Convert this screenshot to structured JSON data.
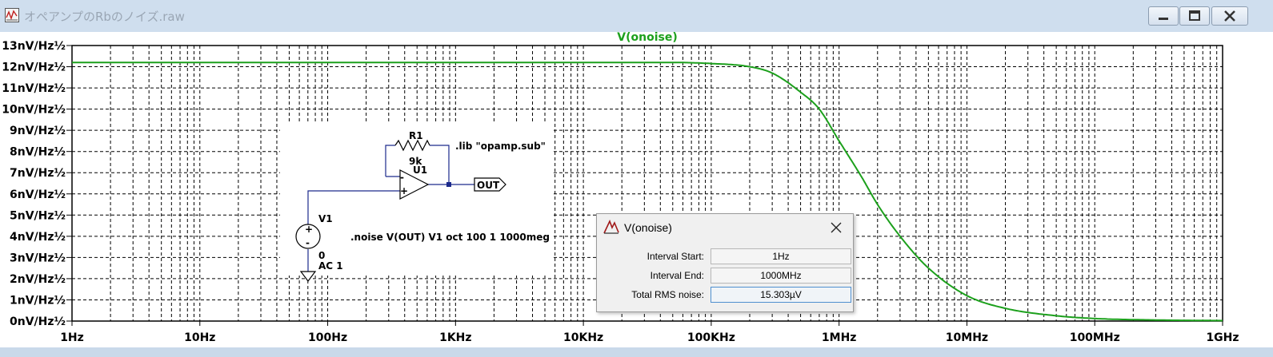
{
  "window": {
    "title": "オペアンプのRbのノイズ.raw",
    "icon": "ltspice-waveform-icon",
    "buttons": [
      "minimize-icon",
      "maximize-icon",
      "close-icon"
    ]
  },
  "plot": {
    "trace_label": "V(onoise)",
    "trace_color": "#1ca01c",
    "y_ticks": [
      "0nV/Hz½",
      "1nV/Hz½",
      "2nV/Hz½",
      "3nV/Hz½",
      "4nV/Hz½",
      "5nV/Hz½",
      "6nV/Hz½",
      "7nV/Hz½",
      "8nV/Hz½",
      "9nV/Hz½",
      "10nV/Hz½",
      "11nV/Hz½",
      "12nV/Hz½",
      "13nV/Hz½"
    ],
    "x_ticks": [
      "1Hz",
      "10Hz",
      "100Hz",
      "1KHz",
      "10KHz",
      "100KHz",
      "1MHz",
      "10MHz",
      "100MHz",
      "1GHz"
    ]
  },
  "chart_data": {
    "type": "line",
    "title": "V(onoise)",
    "x_scale": "log",
    "xlim": [
      1,
      1000000000
    ],
    "ylim": [
      0,
      13
    ],
    "yunit": "nV/Hz½",
    "grid": true,
    "series": [
      {
        "name": "V(onoise)",
        "x": [
          1,
          10,
          100,
          1000,
          10000,
          50000,
          100000,
          200000,
          300000,
          500000,
          700000,
          1000000,
          1500000,
          2000000,
          3000000,
          5000000,
          10000000,
          20000000,
          50000000,
          100000000,
          300000000,
          1000000000
        ],
        "y": [
          12.2,
          12.2,
          12.2,
          12.2,
          12.2,
          12.2,
          12.15,
          12.0,
          11.7,
          10.8,
          10.0,
          8.5,
          6.8,
          5.5,
          4.0,
          2.5,
          1.2,
          0.6,
          0.25,
          0.12,
          0.05,
          0.02
        ]
      }
    ]
  },
  "schematic": {
    "lib_directive": ".lib \"opamp.sub\"",
    "noise_directive": ".noise V(OUT) V1 oct 100 1 1000meg",
    "r1_name": "R1",
    "r1_value": "9k",
    "u1_name": "U1",
    "v1_name": "V1",
    "v1_dc": "0",
    "v1_ac": "AC 1",
    "out_label": "OUT",
    "plus": "+",
    "minus": "-",
    "wire_color": "#1c2a8c"
  },
  "dialog": {
    "title": "V(onoise)",
    "interval_start_label": "Interval Start:",
    "interval_start_value": "1Hz",
    "interval_end_label": "Interval End:",
    "interval_end_value": "1000MHz",
    "total_rms_label": "Total RMS noise:",
    "total_rms_value": "15.303µV"
  }
}
